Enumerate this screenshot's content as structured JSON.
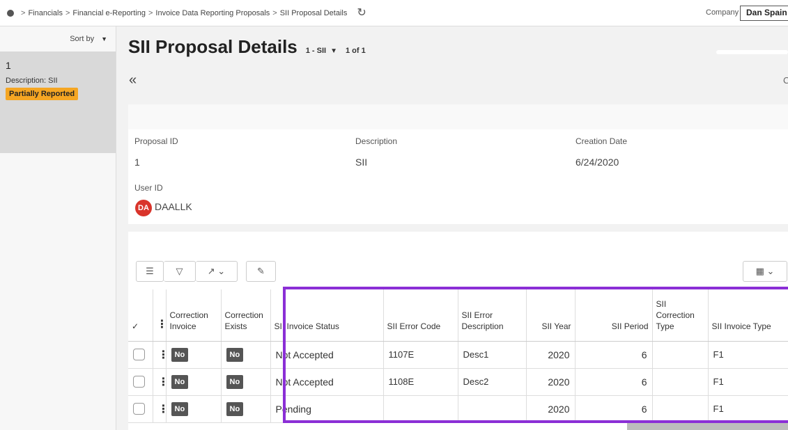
{
  "breadcrumb": [
    "Financials",
    "Financial e-Reporting",
    "Invoice Data Reporting Proposals",
    "SII Proposal Details"
  ],
  "company": {
    "label": "Company",
    "value": "Dan Spain"
  },
  "nav": {
    "sort_label": "Sort by"
  },
  "record": {
    "number": "1",
    "description": "Description:  SII",
    "status": "Partially Reported"
  },
  "header": {
    "title": "SII Proposal Details",
    "selector": "1 - SII",
    "pager": "1 of 1",
    "edge_letter": "C"
  },
  "details": {
    "proposal_id_label": "Proposal ID",
    "proposal_id": "1",
    "description_label": "Description",
    "description": "SII",
    "creation_date_label": "Creation Date",
    "creation_date": "6/24/2020",
    "user_id_label": "User ID",
    "user_initials": "DA",
    "user_id": "DAALLK"
  },
  "table": {
    "columns": [
      "Correction Invoice",
      "Correction Exists",
      "SII Invoice Status",
      "SII Error Code",
      "SII Error Description",
      "SII Year",
      "SII Period",
      "SII Correction Type",
      "SII Invoice Type"
    ],
    "rows": [
      {
        "correction_invoice": "No",
        "correction_exists": "No",
        "status": "Not Accepted",
        "error_code": "1107E",
        "error_desc": "Desc1",
        "year": "2020",
        "period": "6",
        "correction_type": "",
        "invoice_type": "F1"
      },
      {
        "correction_invoice": "No",
        "correction_exists": "No",
        "status": "Not Accepted",
        "error_code": "1108E",
        "error_desc": "Desc2",
        "year": "2020",
        "period": "6",
        "correction_type": "",
        "invoice_type": "F1"
      },
      {
        "correction_invoice": "No",
        "correction_exists": "No",
        "status": "Pending",
        "error_code": "",
        "error_desc": "",
        "year": "2020",
        "period": "6",
        "correction_type": "",
        "invoice_type": "F1"
      }
    ]
  },
  "colors": {
    "highlight": "#8b2fd6",
    "badge": "#f5a623",
    "avatar": "#d9342b"
  }
}
